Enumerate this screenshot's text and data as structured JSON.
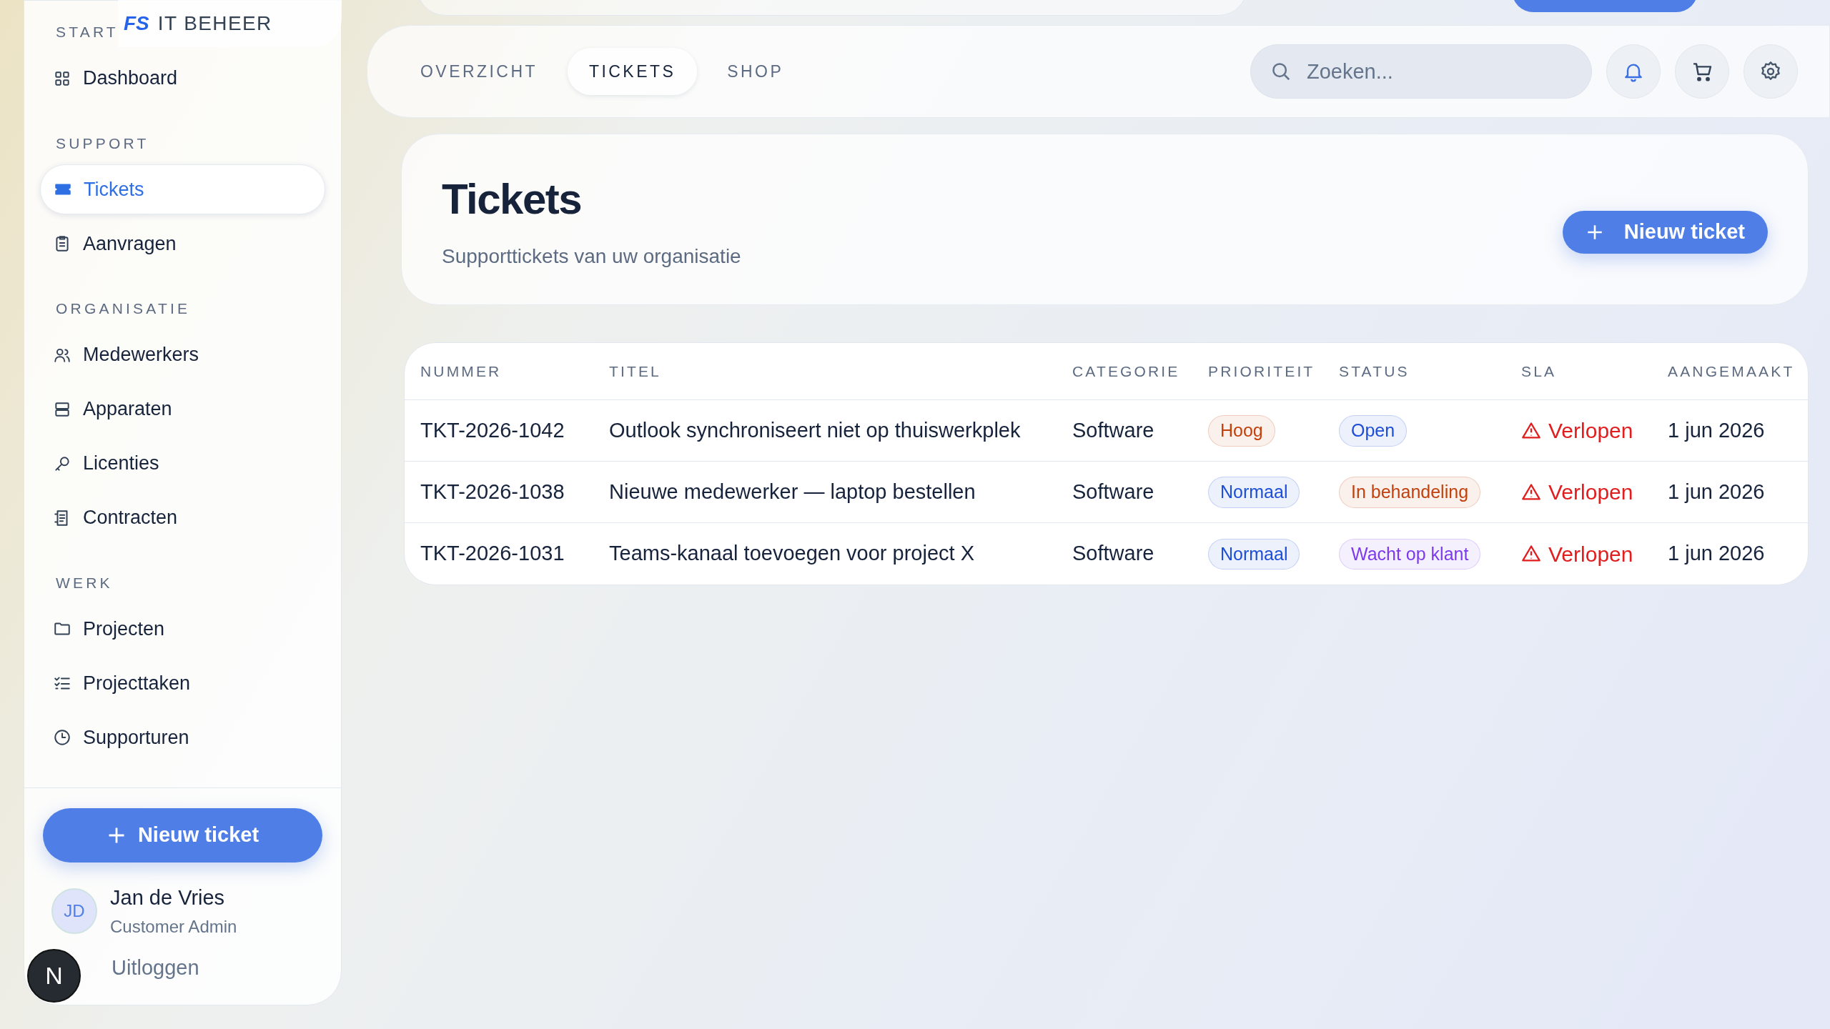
{
  "brand": {
    "logo": "FS",
    "name": "IT BEHEER"
  },
  "sidebar": {
    "sections": [
      {
        "label": "START",
        "items": [
          {
            "label": "Dashboard",
            "selected": false
          }
        ]
      },
      {
        "label": "SUPPORT",
        "items": [
          {
            "label": "Tickets",
            "selected": true
          },
          {
            "label": "Aanvragen",
            "selected": false
          }
        ]
      },
      {
        "label": "ORGANISATIE",
        "items": [
          {
            "label": "Medewerkers",
            "selected": false
          },
          {
            "label": "Apparaten",
            "selected": false
          },
          {
            "label": "Licenties",
            "selected": false
          },
          {
            "label": "Contracten",
            "selected": false
          }
        ]
      },
      {
        "label": "WERK",
        "items": [
          {
            "label": "Projecten",
            "selected": false
          },
          {
            "label": "Projecttaken",
            "selected": false
          },
          {
            "label": "Supporturen",
            "selected": false
          }
        ]
      }
    ],
    "new_ticket_button": "Nieuw ticket",
    "user": {
      "initials": "JD",
      "name": "Jan de Vries",
      "role": "Customer Admin"
    },
    "logout": "Uitloggen"
  },
  "dev_badge": "N",
  "tabs": [
    {
      "label": "OVERZICHT",
      "selected": false
    },
    {
      "label": "TICKETS",
      "selected": true
    },
    {
      "label": "SHOP",
      "selected": false
    }
  ],
  "search": {
    "placeholder": "Zoeken..."
  },
  "page": {
    "title": "Tickets",
    "subtitle": "Supporttickets van uw organisatie",
    "new_ticket_button": "Nieuw ticket"
  },
  "table": {
    "columns": [
      "NUMMER",
      "TITEL",
      "CATEGORIE",
      "PRIORITEIT",
      "STATUS",
      "SLA",
      "AANGEMAAKT"
    ],
    "rows": [
      {
        "number": "TKT-2026-1042",
        "title": "Outlook synchroniseert niet op thuiswerkplek",
        "category": "Software",
        "priority": {
          "label": "Hoog",
          "color": "#c2410c"
        },
        "status": {
          "label": "Open",
          "color": "#1d4ed8"
        },
        "sla": "Verlopen",
        "created": "1 jun 2026"
      },
      {
        "number": "TKT-2026-1038",
        "title": "Nieuwe medewerker — laptop bestellen",
        "category": "Software",
        "priority": {
          "label": "Normaal",
          "color": "#1d4ed8"
        },
        "status": {
          "label": "In behandeling",
          "color": "#c2410c"
        },
        "sla": "Verlopen",
        "created": "1 jun 2026"
      },
      {
        "number": "TKT-2026-1031",
        "title": "Teams-kanaal toevoegen voor project X",
        "category": "Software",
        "priority": {
          "label": "Normaal",
          "color": "#1d4ed8"
        },
        "status": {
          "label": "Wacht op klant",
          "color": "#7c3aed"
        },
        "sla": "Verlopen",
        "created": "1 jun 2026"
      }
    ]
  }
}
